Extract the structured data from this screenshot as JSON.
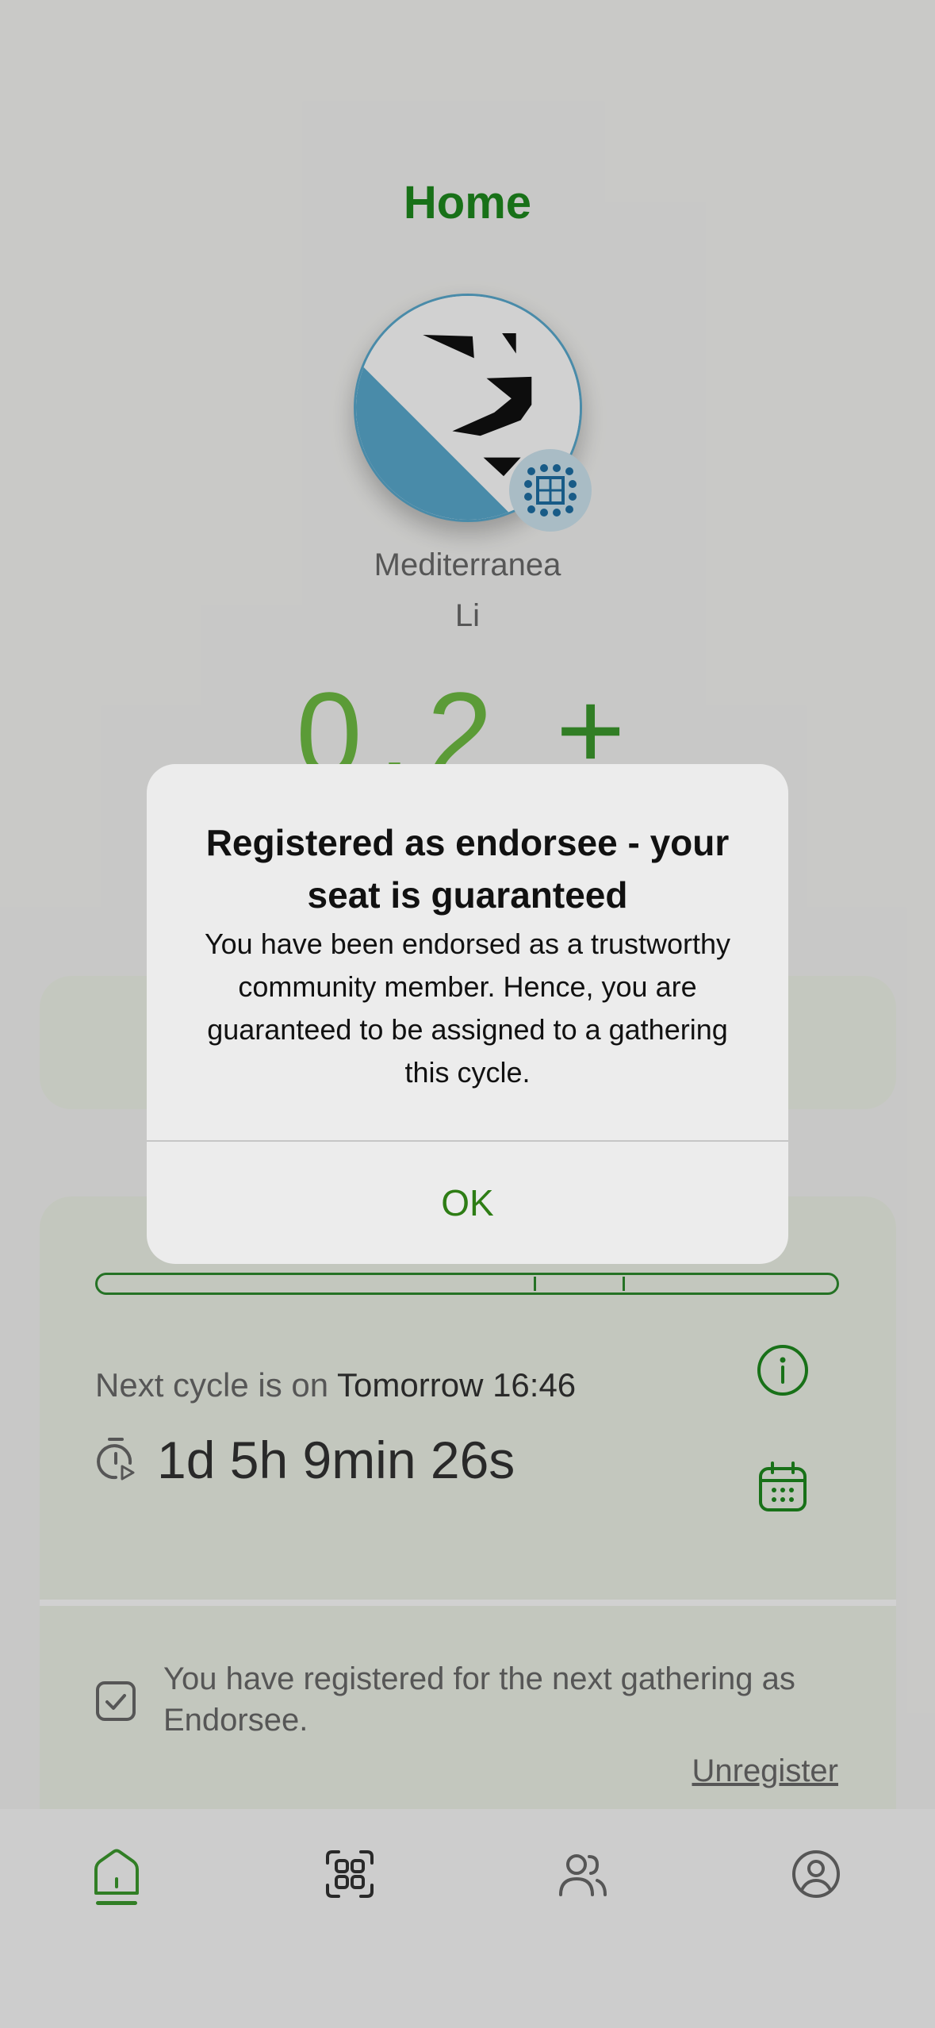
{
  "header": {
    "title": "Home"
  },
  "profile": {
    "first_name": "Mediterranea",
    "last_name": "Li"
  },
  "balance": {
    "amount": "0.2",
    "unit": "±"
  },
  "cycle": {
    "progress_ticks": [
      0.59,
      0.71
    ],
    "next_cycle_prefix": "Next cycle is on",
    "next_cycle_time": "Tomorrow 16:46",
    "countdown": "1d 5h 9min 26s",
    "info_icon": "info-circle-icon",
    "calendar_icon": "calendar-icon"
  },
  "registration": {
    "text": "You have registered for the next gathering as Endorsee.",
    "unregister_label": "Unregister"
  },
  "tabs": [
    {
      "name": "home",
      "icon": "home-icon",
      "active": true
    },
    {
      "name": "scan",
      "icon": "qr-scan-icon",
      "active": false
    },
    {
      "name": "community",
      "icon": "people-icon",
      "active": false
    },
    {
      "name": "profile",
      "icon": "user-circle-icon",
      "active": false
    }
  ],
  "alert": {
    "title": "Registered as endorsee - your seat is guaranteed",
    "message": "You have been endorsed as a trustworthy community member. Hence, you are guaranteed to be assigned to a gathering this cycle.",
    "ok_label": "OK"
  },
  "colors": {
    "accent": "#1e8a1e",
    "alert_button": "#2e7d15",
    "avatar_blue": "#5aaacf"
  }
}
